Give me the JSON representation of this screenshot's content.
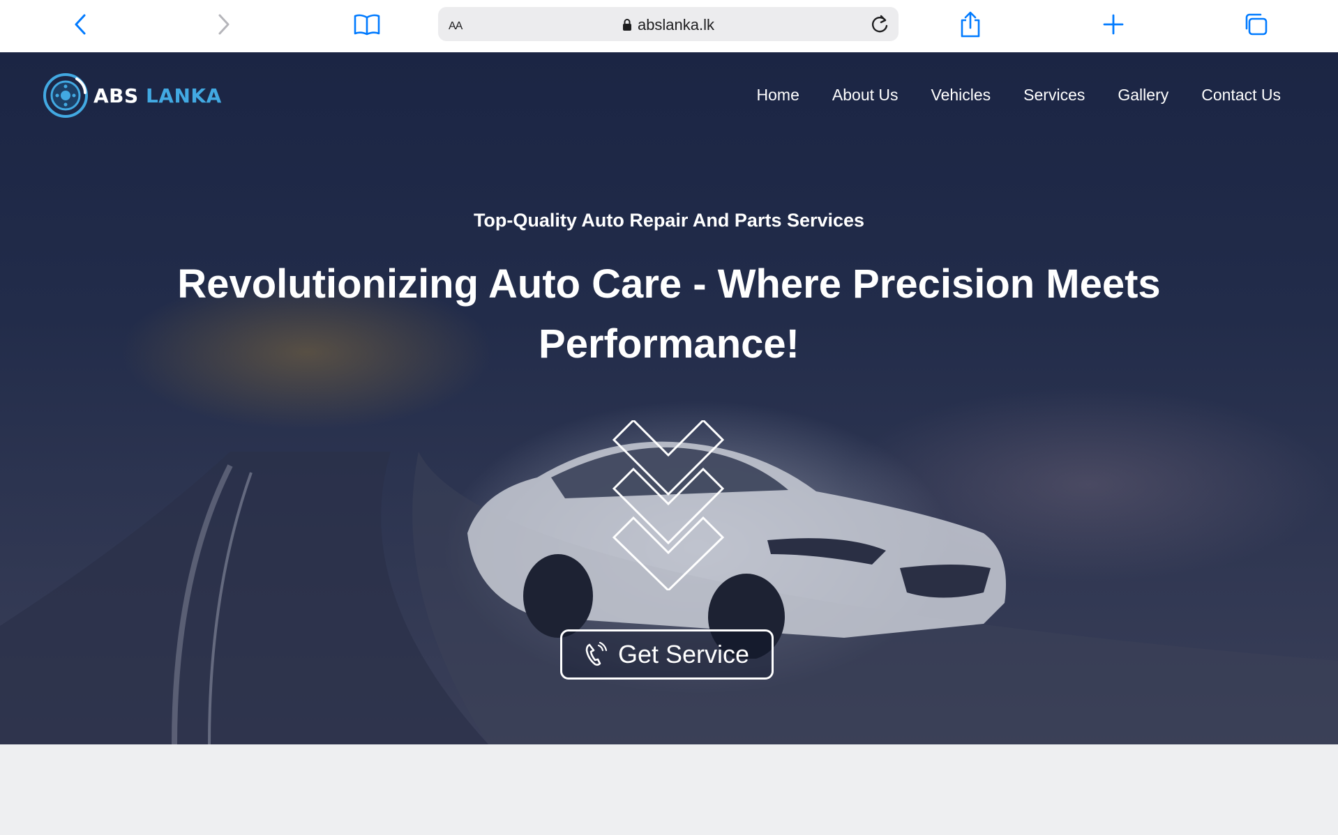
{
  "browser": {
    "text_size_label": "AA",
    "url": "abslanka.lk"
  },
  "site": {
    "logo": {
      "abs": "ABS",
      "lanka": "LANKA"
    },
    "nav": [
      "Home",
      "About Us",
      "Vehicles",
      "Services",
      "Gallery",
      "Contact Us"
    ]
  },
  "hero": {
    "tagline": "Top-Quality Auto Repair And Parts Services",
    "headline": "Revolutionizing Auto Care - Where Precision Meets Performance!",
    "cta_label": "Get Service"
  },
  "colors": {
    "ios_blue": "#007aff",
    "brand_blue": "#42a9e2",
    "hero_overlay": "#1b2544"
  }
}
